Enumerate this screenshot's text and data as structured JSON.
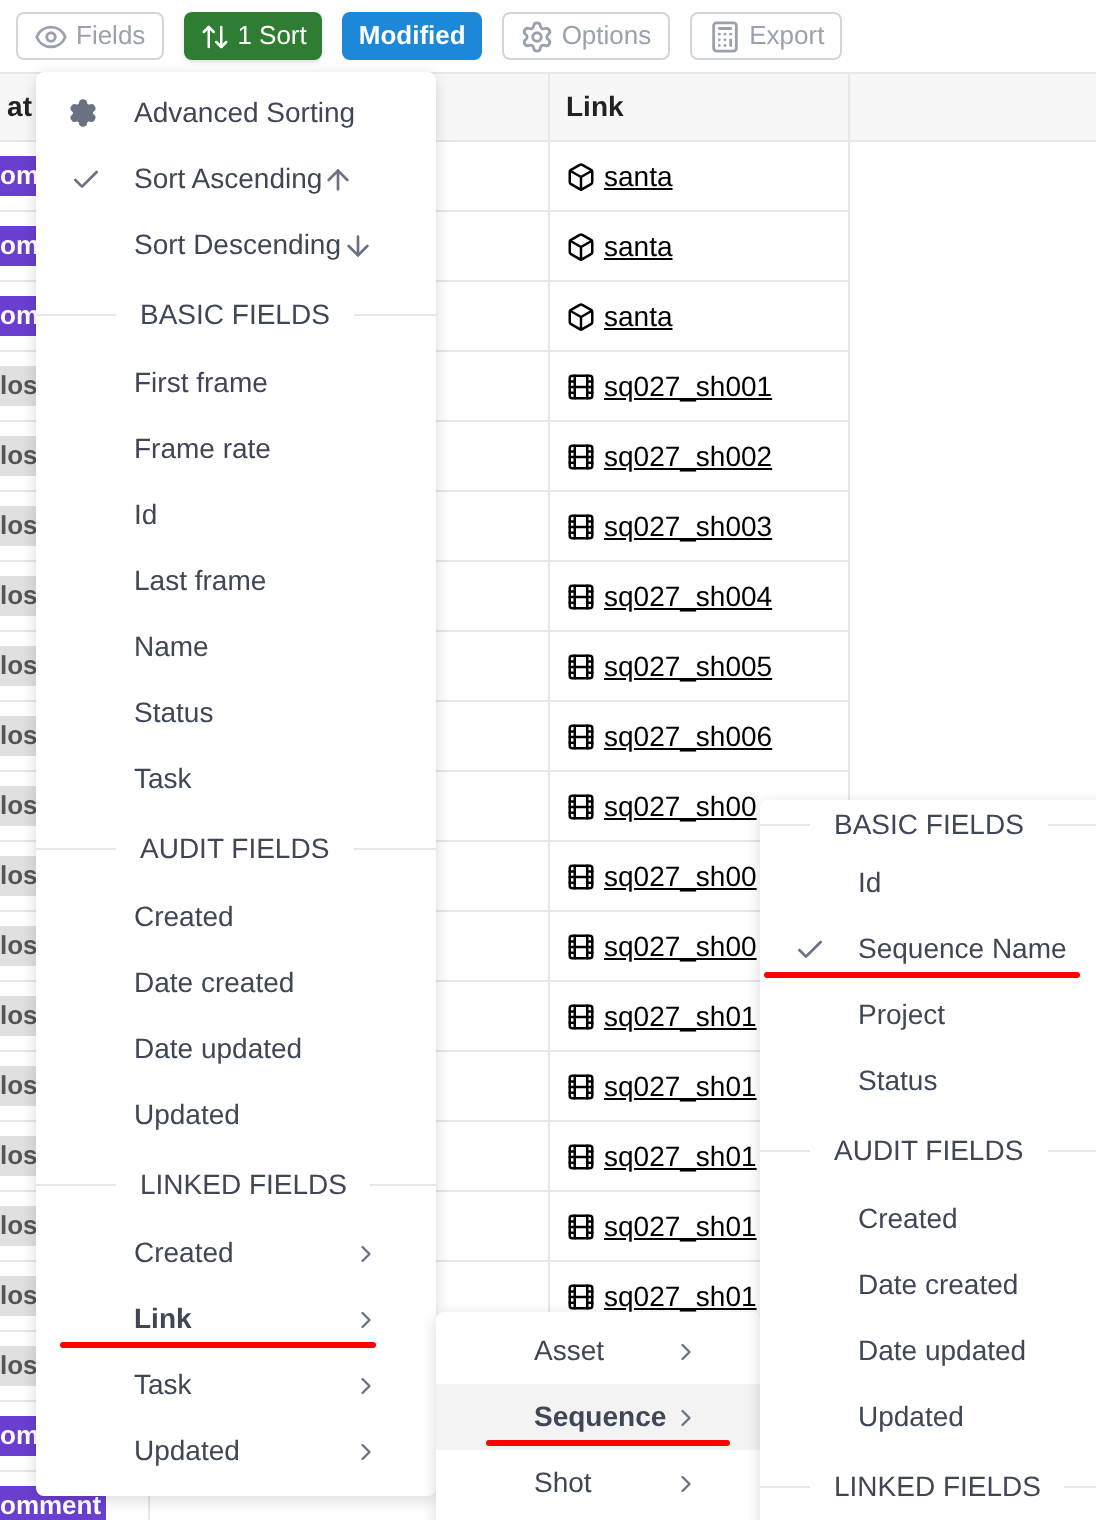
{
  "toolbar": [
    {
      "kind": "fields",
      "label": "Fields"
    },
    {
      "kind": "sort",
      "label": "1 Sort"
    },
    {
      "kind": "modified",
      "label": "Modified"
    },
    {
      "kind": "options",
      "label": "Options"
    },
    {
      "kind": "export",
      "label": "Export"
    }
  ],
  "table": {
    "columns": [
      "at",
      "Link"
    ],
    "rows": [
      {
        "status": {
          "text": "om",
          "kind": "comment"
        },
        "link": {
          "text": "santa",
          "kind": "asset"
        }
      },
      {
        "status": {
          "text": "om",
          "kind": "comment"
        },
        "link": {
          "text": "santa",
          "kind": "asset"
        }
      },
      {
        "status": {
          "text": "om",
          "kind": "comment"
        },
        "link": {
          "text": "santa",
          "kind": "asset"
        }
      },
      {
        "status": {
          "text": "los",
          "kind": "closed"
        },
        "link": {
          "text": "sq027_sh001",
          "kind": "shot"
        }
      },
      {
        "status": {
          "text": "los",
          "kind": "closed"
        },
        "link": {
          "text": "sq027_sh002",
          "kind": "shot"
        }
      },
      {
        "status": {
          "text": "los",
          "kind": "closed"
        },
        "link": {
          "text": "sq027_sh003",
          "kind": "shot"
        }
      },
      {
        "status": {
          "text": "los",
          "kind": "closed"
        },
        "link": {
          "text": "sq027_sh004",
          "kind": "shot"
        }
      },
      {
        "status": {
          "text": "los",
          "kind": "closed"
        },
        "link": {
          "text": "sq027_sh005",
          "kind": "shot"
        }
      },
      {
        "status": {
          "text": "los",
          "kind": "closed"
        },
        "link": {
          "text": "sq027_sh006",
          "kind": "shot"
        }
      },
      {
        "status": {
          "text": "los",
          "kind": "closed"
        },
        "link": {
          "text": "sq027_sh00",
          "kind": "shot"
        }
      },
      {
        "status": {
          "text": "los",
          "kind": "closed"
        },
        "link": {
          "text": "sq027_sh00",
          "kind": "shot"
        }
      },
      {
        "status": {
          "text": "los",
          "kind": "closed"
        },
        "link": {
          "text": "sq027_sh00",
          "kind": "shot"
        }
      },
      {
        "status": {
          "text": "los",
          "kind": "closed"
        },
        "link": {
          "text": "sq027_sh01",
          "kind": "shot"
        }
      },
      {
        "status": {
          "text": "los",
          "kind": "closed"
        },
        "link": {
          "text": "sq027_sh01",
          "kind": "shot"
        }
      },
      {
        "status": {
          "text": "los",
          "kind": "closed"
        },
        "link": {
          "text": "sq027_sh01",
          "kind": "shot"
        }
      },
      {
        "status": {
          "text": "los",
          "kind": "closed"
        },
        "link": {
          "text": "sq027_sh01",
          "kind": "shot"
        }
      },
      {
        "status": {
          "text": "los",
          "kind": "closed"
        },
        "link": {
          "text": "sq027_sh01",
          "kind": "shot"
        }
      },
      {
        "status": {
          "text": "los",
          "kind": "closed"
        }
      },
      {
        "status": {
          "text": "om",
          "kind": "comment"
        }
      },
      {
        "status": {
          "text": "omment",
          "kind": "comment"
        }
      }
    ]
  },
  "sort_menu": {
    "items": [
      {
        "kind": "advanced",
        "label": "Advanced Sorting"
      },
      {
        "kind": "ascending",
        "label": "Sort Ascending",
        "checked": true
      },
      {
        "kind": "descending",
        "label": "Sort Descending",
        "checked": false
      },
      {
        "kind": "header",
        "label": "BASIC FIELDS"
      },
      {
        "kind": "field",
        "label": "First frame"
      },
      {
        "kind": "field",
        "label": "Frame rate"
      },
      {
        "kind": "field",
        "label": "Id"
      },
      {
        "kind": "field",
        "label": "Last frame"
      },
      {
        "kind": "field",
        "label": "Name"
      },
      {
        "kind": "field",
        "label": "Status"
      },
      {
        "kind": "field",
        "label": "Task"
      },
      {
        "kind": "header",
        "label": "AUDIT FIELDS"
      },
      {
        "kind": "field",
        "label": "Created"
      },
      {
        "kind": "field",
        "label": "Date created"
      },
      {
        "kind": "field",
        "label": "Date updated"
      },
      {
        "kind": "field",
        "label": "Updated"
      },
      {
        "kind": "header",
        "label": "LINKED FIELDS"
      },
      {
        "kind": "submenu",
        "label": "Created",
        "selected": false,
        "underlined": false
      },
      {
        "kind": "submenu",
        "label": "Link",
        "selected": true,
        "underlined": true
      },
      {
        "kind": "submenu",
        "label": "Task",
        "selected": false,
        "underlined": false
      },
      {
        "kind": "submenu",
        "label": "Updated",
        "selected": false,
        "underlined": false
      }
    ]
  },
  "link_submenu": {
    "items": [
      {
        "kind": "submenu",
        "label": "Asset",
        "selected": false,
        "underlined": false
      },
      {
        "kind": "submenu",
        "label": "Sequence",
        "selected": true,
        "underlined": true
      },
      {
        "kind": "submenu",
        "label": "Shot",
        "selected": false,
        "underlined": false
      }
    ]
  },
  "sequence_submenu": {
    "items": [
      {
        "kind": "header",
        "label": "BASIC FIELDS"
      },
      {
        "kind": "field",
        "label": "Id",
        "checked": false,
        "underlined": false
      },
      {
        "kind": "field",
        "label": "Sequence Name",
        "checked": true,
        "underlined": true
      },
      {
        "kind": "field",
        "label": "Project",
        "checked": false,
        "underlined": false
      },
      {
        "kind": "field",
        "label": "Status",
        "checked": false,
        "underlined": false
      },
      {
        "kind": "header",
        "label": "AUDIT FIELDS"
      },
      {
        "kind": "field",
        "label": "Created",
        "checked": false,
        "underlined": false
      },
      {
        "kind": "field",
        "label": "Date created",
        "checked": false,
        "underlined": false
      },
      {
        "kind": "field",
        "label": "Date updated",
        "checked": false,
        "underlined": false
      },
      {
        "kind": "field",
        "label": "Updated",
        "checked": false,
        "underlined": false
      },
      {
        "kind": "header",
        "label": "LINKED FIELDS"
      }
    ]
  }
}
